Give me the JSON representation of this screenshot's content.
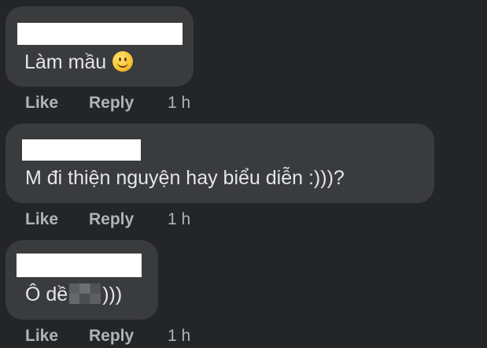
{
  "comments": [
    {
      "text": "Làm mầu",
      "has_emoji": true,
      "emoji_icon": "smiley-face-icon",
      "like_label": "Like",
      "reply_label": "Reply",
      "timestamp": "1 h"
    },
    {
      "text": "M đi thiện nguyện hay biểu diễn :)))?",
      "like_label": "Like",
      "reply_label": "Reply",
      "timestamp": "1 h"
    },
    {
      "text_before": "Ô dề",
      "text_after": ")))",
      "like_label": "Like",
      "reply_label": "Reply",
      "timestamp": "1 h"
    }
  ],
  "colors": {
    "background": "#232527",
    "bubble": "#3a3b3d",
    "text": "#e4e6eb",
    "secondary_text": "#b0b3b8",
    "redaction": "#ffffff"
  }
}
